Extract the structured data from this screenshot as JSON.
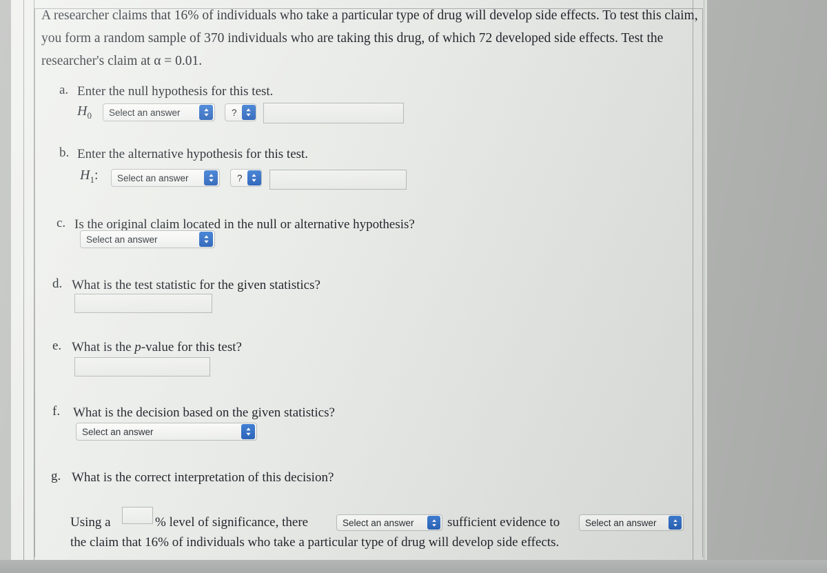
{
  "problem": {
    "statement": "A researcher claims that 16% of individuals who take a particular type of drug will develop side effects. To test this claim, you form a random sample of 370 individuals who are taking this drug, of which 72 developed side effects. Test the researcher's claim at α = 0.01.",
    "claim_percent": "16%",
    "sample_size": "370",
    "successes": "72",
    "alpha": "0.01"
  },
  "select_placeholder": "Select an answer",
  "question_mark": "?",
  "parts": {
    "a": {
      "marker": "a.",
      "text": "Enter the null hypothesis for this test.",
      "hypothesis_label": "H",
      "hypothesis_sub": "0",
      "hypothesis_suffix": "",
      "dropdown": "Select an answer",
      "operator": "?",
      "value": ""
    },
    "b": {
      "marker": "b.",
      "text": "Enter the alternative hypothesis for this test.",
      "hypothesis_label": "H",
      "hypothesis_sub": "1",
      "hypothesis_suffix": ":",
      "dropdown": "Select an answer",
      "operator": "?",
      "value": ""
    },
    "c": {
      "marker": "c.",
      "text": "Is the original claim located in the null or alternative hypothesis?",
      "dropdown": "Select an answer"
    },
    "d": {
      "marker": "d.",
      "text": "What is the test statistic for the given statistics?",
      "value": ""
    },
    "e": {
      "marker": "e.",
      "text_before": "What is the ",
      "text_italic": "p",
      "text_after": "-value for this test?",
      "value": ""
    },
    "f": {
      "marker": "f.",
      "text": "What is the decision based on the given statistics?",
      "dropdown": "Select an answer"
    },
    "g": {
      "marker": "g.",
      "text": "What is the correct interpretation of this decision?",
      "sentence": {
        "lead": "Using a",
        "significance_value": "",
        "after_box": "% level of significance, there",
        "dropdown_1": "Select an answer",
        "middle": "sufficient evidence to",
        "dropdown_2": "Select an answer",
        "final_line": "the claim that 16% of individuals who take a particular type of drug will develop side effects."
      }
    }
  },
  "colors": {
    "accent_blue": "#2f6cc4",
    "text": "#20252b",
    "page_bg": "#e9ebe8",
    "control_border": "#b9bdbb"
  }
}
